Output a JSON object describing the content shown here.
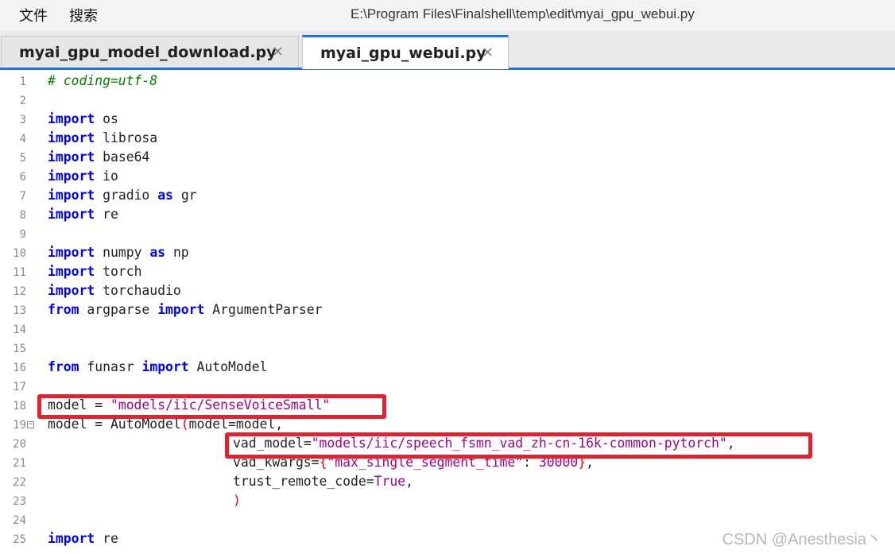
{
  "menu": {
    "file": "文件",
    "search": "搜索"
  },
  "file_path": "E:\\Program Files\\Finalshell\\temp\\edit\\myai_gpu_webui.py",
  "tabs": [
    {
      "label": "myai_gpu_model_download.py",
      "close": "×",
      "active": false
    },
    {
      "label": "myai_gpu_webui.py",
      "close": "×",
      "active": true
    }
  ],
  "code": {
    "line_numbers": [
      "1",
      "2",
      "3",
      "4",
      "5",
      "6",
      "7",
      "8",
      "9",
      "10",
      "11",
      "12",
      "13",
      "14",
      "15",
      "16",
      "17",
      "18",
      "19",
      "20",
      "21",
      "22",
      "23",
      "24",
      "25"
    ],
    "comment_line1": "# coding=utf-8",
    "kw_import": "import",
    "kw_from": "from",
    "kw_as": "as",
    "mod_os": "os",
    "mod_librosa": "librosa",
    "mod_base64": "base64",
    "mod_io": "io",
    "mod_gradio": "gradio",
    "alias_gr": "gr",
    "mod_re": "re",
    "mod_numpy": "numpy",
    "alias_np": "np",
    "mod_torch": "torch",
    "mod_torchaudio": "torchaudio",
    "mod_argparse": "argparse",
    "cls_argparser": "ArgumentParser",
    "mod_funasr": "funasr",
    "cls_automodel": "AutoModel",
    "line18_lhs": "model = ",
    "line18_str": "\"models/iic/SenseVoiceSmall\"",
    "line19_a": "model = AutoModel",
    "line19_paren": "(",
    "line19_b": "model=model,",
    "line20_a": "vad_model=",
    "line20_str": "\"models/iic/speech_fsmn_vad_zh-cn-16k-common-pytorch\"",
    "line20_b": ",",
    "line21_a": "vad_kwargs=",
    "line21_brace_open": "{",
    "line21_key": "\"max_single_segment_time\"",
    "line21_colon": ": ",
    "line21_num": "30000",
    "line21_brace_close": "}",
    "line21_comma": ",",
    "line22_a": "trust_remote_code=",
    "line22_const": "True",
    "line22_comma": ",",
    "line23_paren": ")",
    "fold_symbol": "−"
  },
  "watermark": "CSDN @Anesthesia丶",
  "colors": {
    "keyword": "#0000ff",
    "string": "#a0008f",
    "comment": "#008000",
    "highlight_box": "#e8202e",
    "tab_accent": "#1a73e8"
  }
}
